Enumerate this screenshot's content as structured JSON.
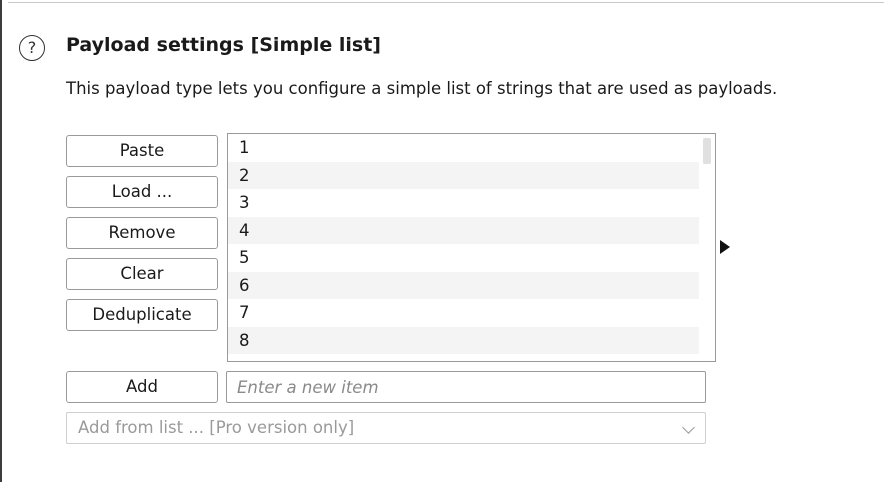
{
  "section": {
    "title": "Payload settings [Simple list]",
    "description": "This payload type lets you configure a simple list of strings that are used as payloads.",
    "help_icon": "?"
  },
  "buttons": {
    "paste": "Paste",
    "load": "Load ...",
    "remove": "Remove",
    "clear": "Clear",
    "deduplicate": "Deduplicate",
    "add": "Add"
  },
  "payload_list": {
    "items": [
      "1",
      "2",
      "3",
      "4",
      "5",
      "6",
      "7",
      "8"
    ]
  },
  "new_item": {
    "value": "",
    "placeholder": "Enter a new item"
  },
  "add_from_list": {
    "selected": "Add from list ... [Pro version only]",
    "disabled": true
  },
  "icons": {
    "help": "help-circle-icon",
    "arrow": "caret-right-icon",
    "dropdown": "chevron-down-icon"
  },
  "colors": {
    "alt_row": "#f4f4f4",
    "border": "#9a9a9a",
    "disabled_text": "#9a9a9a",
    "placeholder_text": "#8a8a8a"
  }
}
